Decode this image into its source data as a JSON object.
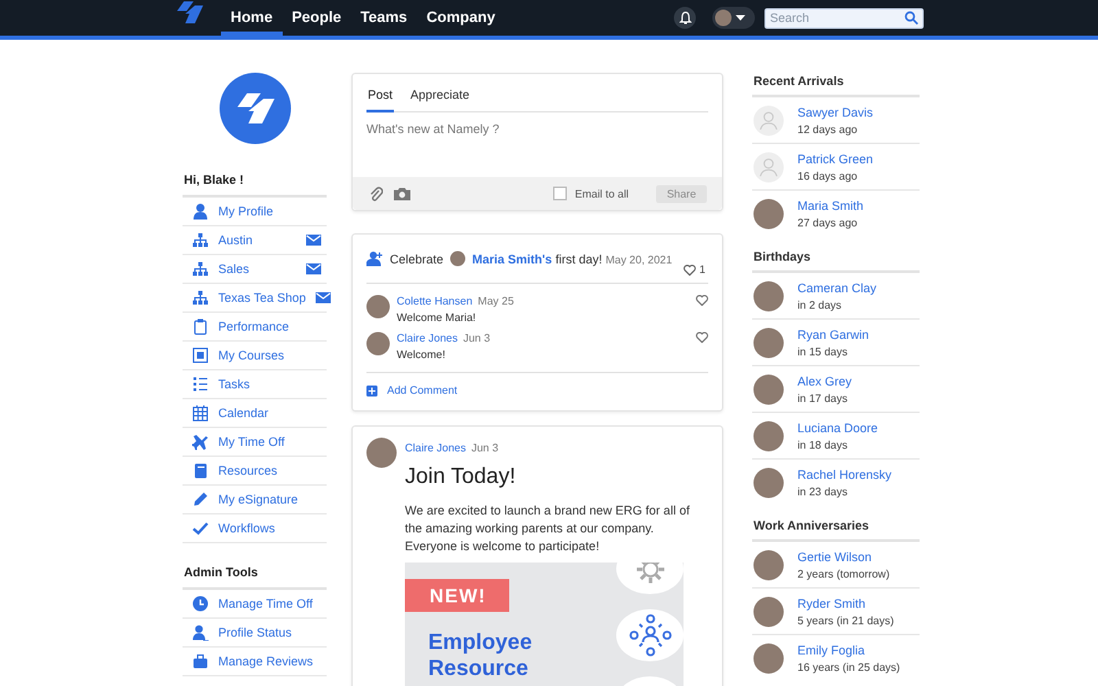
{
  "nav": {
    "tabs": [
      {
        "label": "Home",
        "selected": true
      },
      {
        "label": "People",
        "selected": false
      },
      {
        "label": "Teams",
        "selected": false
      },
      {
        "label": "Company",
        "selected": false
      }
    ],
    "search": {
      "placeholder": "Search"
    }
  },
  "sidebar": {
    "greeting": "Hi, Blake !",
    "items": [
      {
        "label": "My Profile",
        "email": false
      },
      {
        "label": "Austin",
        "email": true
      },
      {
        "label": "Sales",
        "email": true
      },
      {
        "label": "Texas Tea Shop",
        "email": true
      },
      {
        "label": "Performance",
        "email": false
      },
      {
        "label": "My Courses",
        "email": false
      },
      {
        "label": "Tasks",
        "email": false
      },
      {
        "label": "Calendar",
        "email": false
      },
      {
        "label": "My Time Off",
        "email": false
      },
      {
        "label": "Resources",
        "email": false
      },
      {
        "label": "My eSignature",
        "email": false
      },
      {
        "label": "Workflows",
        "email": false
      }
    ],
    "admin_title": "Admin Tools",
    "admin_items": [
      {
        "label": "Manage Time Off"
      },
      {
        "label": "Profile Status"
      },
      {
        "label": "Manage Reviews"
      }
    ]
  },
  "composer": {
    "tabs": [
      {
        "label": "Post",
        "selected": true
      },
      {
        "label": "Appreciate",
        "selected": false
      }
    ],
    "placeholder": "What's new at Namely ?",
    "email_label": "Email to all",
    "email_checked": false,
    "share": "Share",
    "share_disabled": true
  },
  "celebration": {
    "verb": "Celebrate",
    "name": "Maria Smith's",
    "rest": "first day!",
    "date": "May 20, 2021",
    "likes": "1",
    "comments": [
      {
        "author": "Colette Hansen",
        "date": "May 25",
        "text": "Welcome Maria!"
      },
      {
        "author": "Claire Jones",
        "date": "Jun 3",
        "text": "Welcome!"
      }
    ],
    "add_comment": "Add Comment"
  },
  "post": {
    "author": "Claire Jones",
    "date": "Jun 3",
    "title": "Join Today!",
    "body": "We are excited to launch a brand new ERG for all of the amazing working parents at our company. Everyone is welcome to participate!",
    "image": {
      "badge": "NEW!",
      "headline": "Employee Resource"
    }
  },
  "panels": [
    {
      "title": "Recent Arrivals",
      "people": [
        {
          "name": "Sawyer Davis",
          "detail": "12 days ago",
          "photo": false
        },
        {
          "name": "Patrick Green",
          "detail": "16 days ago",
          "photo": false
        },
        {
          "name": "Maria Smith",
          "detail": "27 days ago",
          "photo": true
        }
      ]
    },
    {
      "title": "Birthdays",
      "people": [
        {
          "name": "Cameran Clay",
          "detail": "in 2 days",
          "photo": true
        },
        {
          "name": "Ryan Garwin",
          "detail": "in 15 days",
          "photo": true
        },
        {
          "name": "Alex Grey",
          "detail": "in 17 days",
          "photo": true
        },
        {
          "name": "Luciana Doore",
          "detail": "in 18 days",
          "photo": true
        },
        {
          "name": "Rachel Horensky",
          "detail": "in 23 days",
          "photo": true
        }
      ]
    },
    {
      "title": "Work Anniversaries",
      "people": [
        {
          "name": "Gertie Wilson",
          "detail": "2 years (tomorrow)",
          "photo": true
        },
        {
          "name": "Ryder Smith",
          "detail": "5 years (in 21 days)",
          "photo": true
        },
        {
          "name": "Emily Foglia",
          "detail": "16 years (in 25 days)",
          "photo": true
        }
      ]
    }
  ]
}
